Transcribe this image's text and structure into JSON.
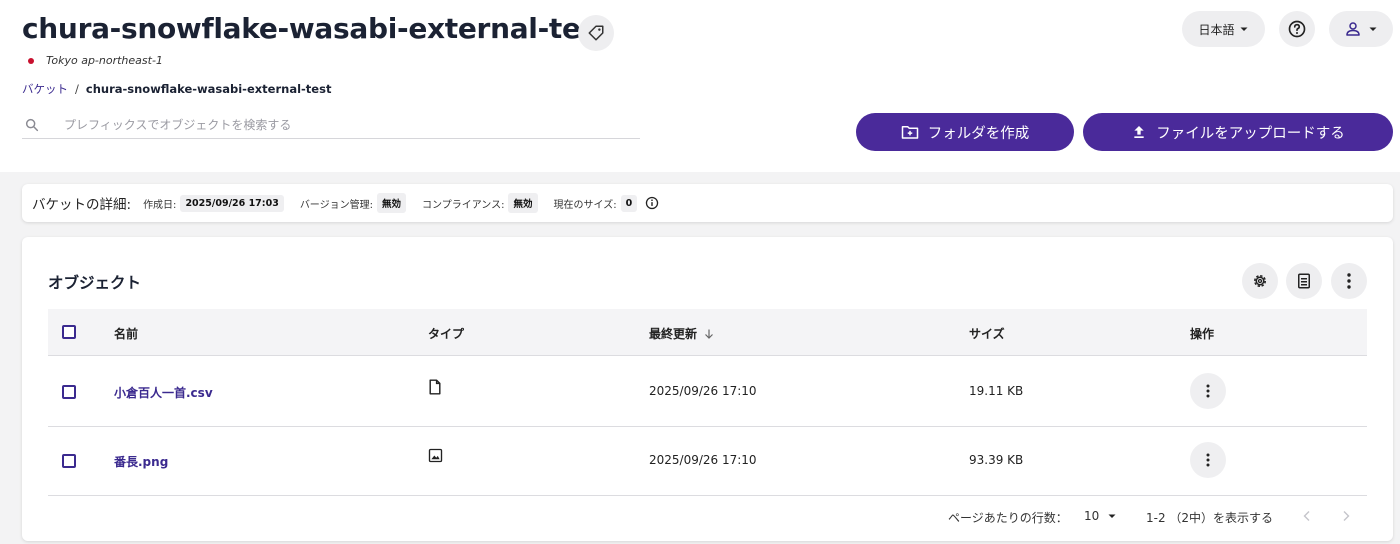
{
  "header": {
    "title": "chura-snowflake-wasabi-external-test",
    "region": "Tokyo ap-northeast-1",
    "language": "日本語"
  },
  "breadcrumb": {
    "root": "バケット",
    "separator": "/",
    "current": "chura-snowflake-wasabi-external-test"
  },
  "search": {
    "placeholder": "プレフィックスでオブジェクトを検索する",
    "value": ""
  },
  "actions": {
    "create_folder": "フォルダを作成",
    "upload_file": "ファイルをアップロードする"
  },
  "details": {
    "label": "バケットの詳細:",
    "created_label": "作成日:",
    "created_value": "2025/09/26 17:03",
    "versioning_label": "バージョン管理:",
    "versioning_value": "無効",
    "compliance_label": "コンプライアンス:",
    "compliance_value": "無効",
    "size_label": "現在のサイズ:",
    "size_value": "0"
  },
  "objects": {
    "title": "オブジェクト",
    "columns": {
      "name": "名前",
      "type": "タイプ",
      "modified": "最終更新",
      "size": "サイズ",
      "actions": "操作"
    },
    "rows": [
      {
        "name": "小倉百人一首.csv",
        "type_icon": "file-icon",
        "modified": "2025/09/26 17:10",
        "size": "19.11 KB"
      },
      {
        "name": "番長.png",
        "type_icon": "image-icon",
        "modified": "2025/09/26 17:10",
        "size": "93.39 KB"
      }
    ],
    "rows_per_page_label": "ページあたりの行数：",
    "rows_per_page": "10",
    "range_text": "1-2 （2中）を表示する"
  },
  "colors": {
    "primary": "#4a2a9a",
    "link": "#3b2a8f",
    "region_dot": "#c8102e"
  }
}
